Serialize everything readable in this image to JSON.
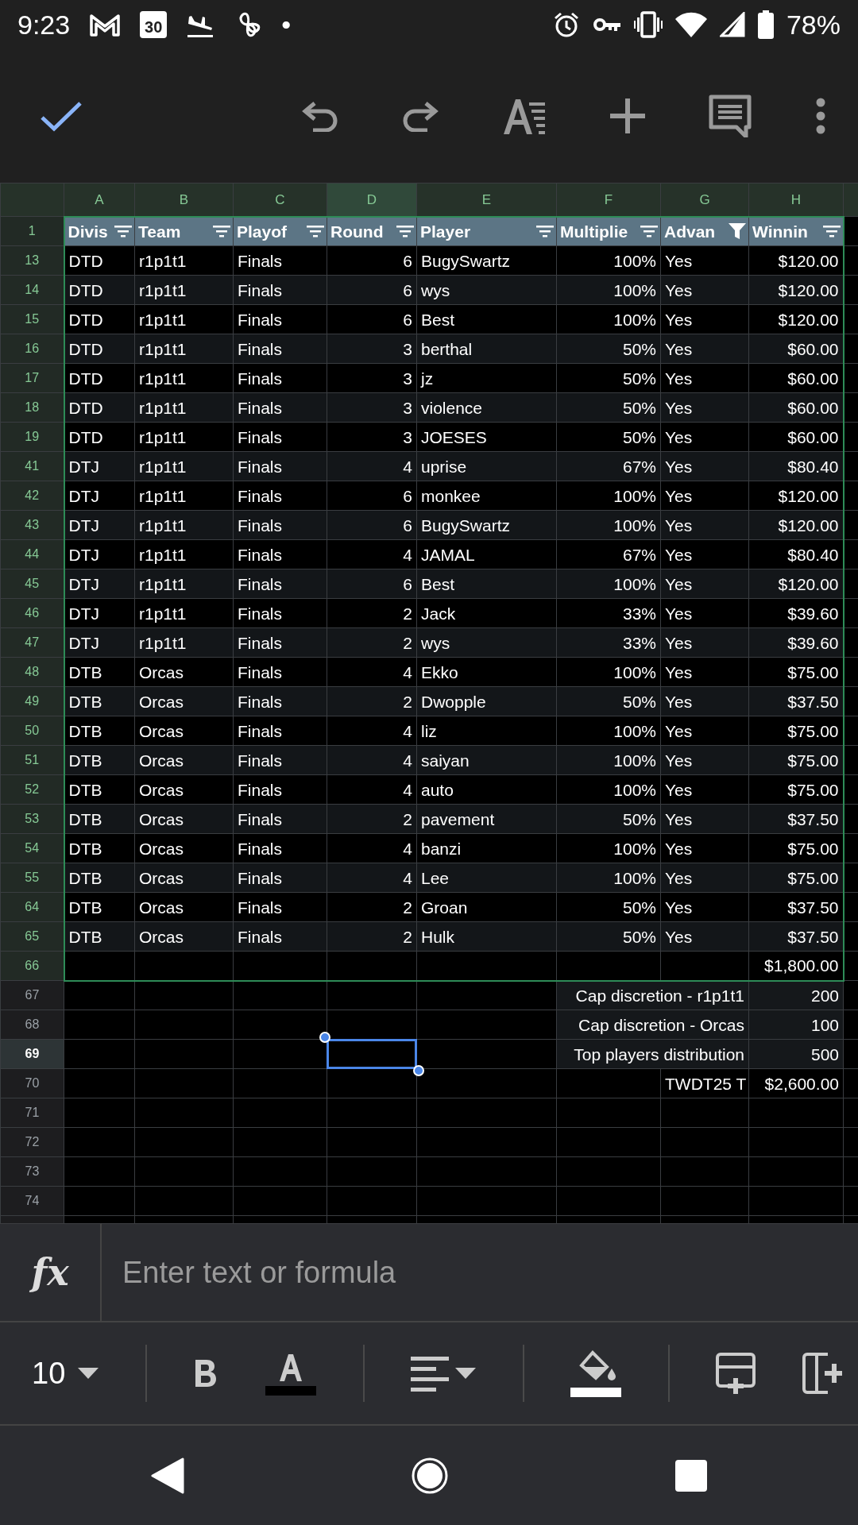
{
  "status_bar": {
    "time": "9:23",
    "calendar_day": "30",
    "dot": "•",
    "battery": "78%"
  },
  "columns": [
    {
      "label": "A",
      "selected": false,
      "header": "Divis",
      "filtered": false,
      "right_aligned": false
    },
    {
      "label": "B",
      "selected": false,
      "header": "Team",
      "filtered": false,
      "right_aligned": false
    },
    {
      "label": "C",
      "selected": false,
      "header": "Playof",
      "filtered": false,
      "right_aligned": false
    },
    {
      "label": "D",
      "selected": true,
      "header": "Round",
      "filtered": false,
      "right_aligned": true
    },
    {
      "label": "E",
      "selected": false,
      "header": "Player",
      "filtered": false,
      "right_aligned": false
    },
    {
      "label": "F",
      "selected": false,
      "header": "Multiplie",
      "filtered": false,
      "right_aligned": true
    },
    {
      "label": "G",
      "selected": false,
      "header": "Advan",
      "filtered": true,
      "right_aligned": false
    },
    {
      "label": "H",
      "selected": false,
      "header": "Winnin",
      "filtered": false,
      "right_aligned": true
    }
  ],
  "header_row": {
    "num": "1"
  },
  "rows": [
    {
      "num": "13",
      "kind": "table",
      "selected": false,
      "cells": [
        "DTD",
        "r1p1t1",
        "Finals",
        "6",
        "BugySwartz",
        "100%",
        "Yes",
        "$120.00"
      ]
    },
    {
      "num": "14",
      "kind": "table",
      "selected": false,
      "cells": [
        "DTD",
        "r1p1t1",
        "Finals",
        "6",
        "wys",
        "100%",
        "Yes",
        "$120.00"
      ]
    },
    {
      "num": "15",
      "kind": "table",
      "selected": false,
      "cells": [
        "DTD",
        "r1p1t1",
        "Finals",
        "6",
        "Best",
        "100%",
        "Yes",
        "$120.00"
      ]
    },
    {
      "num": "16",
      "kind": "table",
      "selected": false,
      "cells": [
        "DTD",
        "r1p1t1",
        "Finals",
        "3",
        "berthal",
        "50%",
        "Yes",
        "$60.00"
      ]
    },
    {
      "num": "17",
      "kind": "table",
      "selected": false,
      "cells": [
        "DTD",
        "r1p1t1",
        "Finals",
        "3",
        "jz",
        "50%",
        "Yes",
        "$60.00"
      ]
    },
    {
      "num": "18",
      "kind": "table",
      "selected": false,
      "cells": [
        "DTD",
        "r1p1t1",
        "Finals",
        "3",
        "violence",
        "50%",
        "Yes",
        "$60.00"
      ]
    },
    {
      "num": "19",
      "kind": "table",
      "selected": false,
      "cells": [
        "DTD",
        "r1p1t1",
        "Finals",
        "3",
        "JOESES",
        "50%",
        "Yes",
        "$60.00"
      ]
    },
    {
      "num": "41",
      "kind": "table",
      "selected": false,
      "cells": [
        "DTJ",
        "r1p1t1",
        "Finals",
        "4",
        "uprise",
        "67%",
        "Yes",
        "$80.40"
      ]
    },
    {
      "num": "42",
      "kind": "table",
      "selected": false,
      "cells": [
        "DTJ",
        "r1p1t1",
        "Finals",
        "6",
        "monkee",
        "100%",
        "Yes",
        "$120.00"
      ]
    },
    {
      "num": "43",
      "kind": "table",
      "selected": false,
      "cells": [
        "DTJ",
        "r1p1t1",
        "Finals",
        "6",
        "BugySwartz",
        "100%",
        "Yes",
        "$120.00"
      ]
    },
    {
      "num": "44",
      "kind": "table",
      "selected": false,
      "cells": [
        "DTJ",
        "r1p1t1",
        "Finals",
        "4",
        "JAMAL",
        "67%",
        "Yes",
        "$80.40"
      ]
    },
    {
      "num": "45",
      "kind": "table",
      "selected": false,
      "cells": [
        "DTJ",
        "r1p1t1",
        "Finals",
        "6",
        "Best",
        "100%",
        "Yes",
        "$120.00"
      ]
    },
    {
      "num": "46",
      "kind": "table",
      "selected": false,
      "cells": [
        "DTJ",
        "r1p1t1",
        "Finals",
        "2",
        "Jack",
        "33%",
        "Yes",
        "$39.60"
      ]
    },
    {
      "num": "47",
      "kind": "table",
      "selected": false,
      "cells": [
        "DTJ",
        "r1p1t1",
        "Finals",
        "2",
        "wys",
        "33%",
        "Yes",
        "$39.60"
      ]
    },
    {
      "num": "48",
      "kind": "table",
      "selected": false,
      "cells": [
        "DTB",
        "Orcas",
        "Finals",
        "4",
        "Ekko",
        "100%",
        "Yes",
        "$75.00"
      ]
    },
    {
      "num": "49",
      "kind": "table",
      "selected": false,
      "cells": [
        "DTB",
        "Orcas",
        "Finals",
        "2",
        "Dwopple",
        "50%",
        "Yes",
        "$37.50"
      ]
    },
    {
      "num": "50",
      "kind": "table",
      "selected": false,
      "cells": [
        "DTB",
        "Orcas",
        "Finals",
        "4",
        "liz",
        "100%",
        "Yes",
        "$75.00"
      ]
    },
    {
      "num": "51",
      "kind": "table",
      "selected": false,
      "cells": [
        "DTB",
        "Orcas",
        "Finals",
        "4",
        "saiyan",
        "100%",
        "Yes",
        "$75.00"
      ]
    },
    {
      "num": "52",
      "kind": "table",
      "selected": false,
      "cells": [
        "DTB",
        "Orcas",
        "Finals",
        "4",
        "auto",
        "100%",
        "Yes",
        "$75.00"
      ]
    },
    {
      "num": "53",
      "kind": "table",
      "selected": false,
      "cells": [
        "DTB",
        "Orcas",
        "Finals",
        "2",
        "pavement",
        "50%",
        "Yes",
        "$37.50"
      ]
    },
    {
      "num": "54",
      "kind": "table",
      "selected": false,
      "cells": [
        "DTB",
        "Orcas",
        "Finals",
        "4",
        "banzi",
        "100%",
        "Yes",
        "$75.00"
      ]
    },
    {
      "num": "55",
      "kind": "table",
      "selected": false,
      "cells": [
        "DTB",
        "Orcas",
        "Finals",
        "4",
        "Lee",
        "100%",
        "Yes",
        "$75.00"
      ]
    },
    {
      "num": "64",
      "kind": "table",
      "selected": false,
      "cells": [
        "DTB",
        "Orcas",
        "Finals",
        "2",
        "Groan",
        "50%",
        "Yes",
        "$37.50"
      ]
    },
    {
      "num": "65",
      "kind": "table",
      "selected": false,
      "cells": [
        "DTB",
        "Orcas",
        "Finals",
        "2",
        "Hulk",
        "50%",
        "Yes",
        "$37.50"
      ]
    },
    {
      "num": "66",
      "kind": "table",
      "selected": false,
      "cells": [
        null,
        null,
        null,
        null,
        null,
        null,
        null,
        "$1,800.00"
      ]
    },
    {
      "num": "67",
      "kind": "note",
      "selected": false,
      "cells": [
        null,
        null,
        null,
        null,
        null,
        "Cap discretion - r1p1t1",
        null,
        "200"
      ]
    },
    {
      "num": "68",
      "kind": "note",
      "selected": false,
      "cells": [
        null,
        null,
        null,
        null,
        null,
        "Cap discretion - Orcas",
        null,
        "100"
      ]
    },
    {
      "num": "69",
      "kind": "note",
      "selected": true,
      "cells": [
        null,
        null,
        null,
        null,
        null,
        "Top players distribution",
        null,
        "500"
      ]
    },
    {
      "num": "70",
      "kind": "plain",
      "selected": false,
      "cells": [
        null,
        null,
        null,
        null,
        null,
        null,
        "TWDT25 T",
        "$2,600.00"
      ]
    },
    {
      "num": "71",
      "kind": "plain",
      "selected": false,
      "cells": [
        null,
        null,
        null,
        null,
        null,
        null,
        null,
        null
      ]
    },
    {
      "num": "72",
      "kind": "plain",
      "selected": false,
      "cells": [
        null,
        null,
        null,
        null,
        null,
        null,
        null,
        null
      ]
    },
    {
      "num": "73",
      "kind": "plain",
      "selected": false,
      "cells": [
        null,
        null,
        null,
        null,
        null,
        null,
        null,
        null
      ]
    },
    {
      "num": "74",
      "kind": "plain",
      "selected": false,
      "cells": [
        null,
        null,
        null,
        null,
        null,
        null,
        null,
        null
      ]
    }
  ],
  "formula_bar": {
    "fx": "fx",
    "placeholder": "Enter text or formula"
  },
  "format_bar": {
    "font_size": "10"
  }
}
